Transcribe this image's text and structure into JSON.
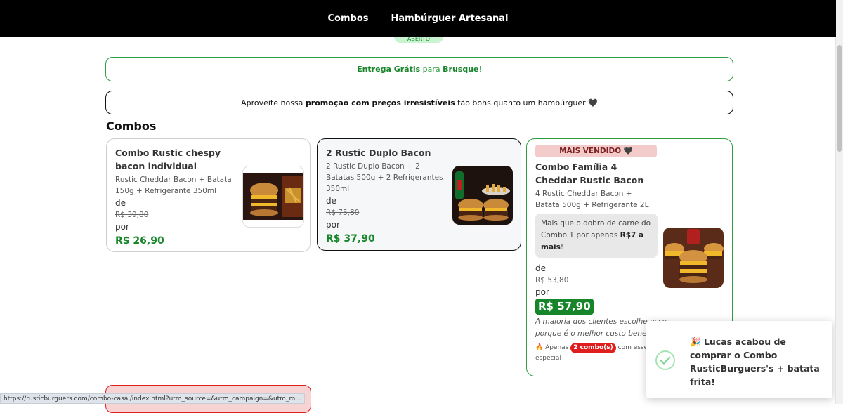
{
  "nav": {
    "items": [
      "Combos",
      "Hambúrguer Artesanal"
    ]
  },
  "status_pill": "ABERTO",
  "banner_delivery": {
    "prefix": "Entrega Grátis",
    "middle": " para ",
    "city": "Brusque",
    "suffix": "!"
  },
  "banner_promo": {
    "prefix": "Aproveite nossa ",
    "bold": "promoção com preços irresistíveis",
    "suffix": " tão bons quanto um hambúrguer 🖤"
  },
  "section_title": "Combos",
  "cards": [
    {
      "title": "Combo Rustic chespy bacon individual",
      "description": "Rustic Cheddar Bacon + Batata 150g + Refrigerante 350ml",
      "de_label": "de",
      "old_price": "R$ 39,80",
      "por_label": "por",
      "price": "R$ 26,90"
    },
    {
      "title": "2 Rustic Duplo Bacon",
      "description": "2 Rustic Duplo Bacon + 2 Batatas 500g + 2 Refrigerantes 350ml",
      "de_label": "de",
      "old_price": "R$ 75,80",
      "por_label": "por",
      "price": "R$ 37,90"
    },
    {
      "badge": "MAIS VENDIDO 🖤",
      "title": "Combo Família 4 Cheddar Rustic Bacon",
      "description": "4 Rustic Cheddar Bacon + Batata 500g + Refrigerante 2L",
      "promo_text": "Mais que o dobro de carne do Combo 1 por apenas ",
      "promo_bold": "R$7 a mais",
      "promo_end": "!",
      "de_label": "de",
      "old_price": "R$ 53,80",
      "por_label": "por",
      "price": "R$ 57,90",
      "note": "A maioria dos clientes escolhe esse porque é o melhor custo benefício!",
      "stock_prefix": "🔥 Apenas ",
      "stock_badge": "2 combo(s)",
      "stock_suffix": " com esse preço especial"
    }
  ],
  "toast": {
    "text": "🎉 Lucas acabou de comprar o Combo RusticBurguers's + batata frita!"
  },
  "status_url": "https://rusticburguers.com/combo-casal/index.html?utm_source=&utm_campaign=&utm_m...",
  "colors": {
    "accent_green": "#17852a",
    "badge_red": "#e01e1e",
    "nav_black": "#000000"
  }
}
